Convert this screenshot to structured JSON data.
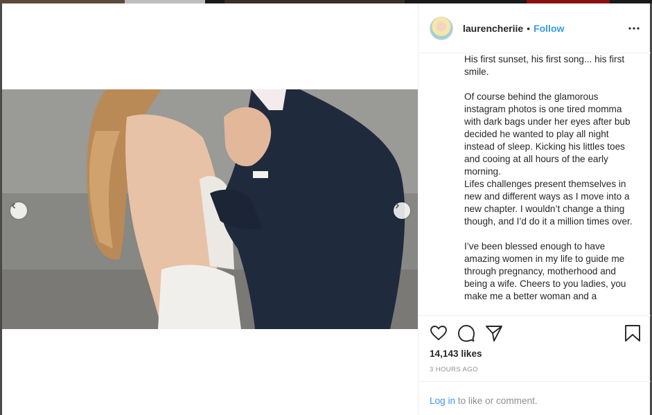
{
  "post": {
    "username": "laurencheriie",
    "separator": "•",
    "follow_label": "Follow",
    "more_icon": "more-options-icon",
    "caption": [
      "His first sunset, his first song... his first smile.",
      "",
      "Of course behind the glamorous instagram photos is one tired momma with dark bags under her eyes after bub decided he wanted to play all night instead of sleep. Kicking his littles toes and cooing at all hours of the early morning.",
      "Lifes challenges present themselves in new and different ways as I move into a new chapter. I wouldn’t change a thing though, and I’d do it a million times over.",
      "",
      "I’ve been blessed enough to have amazing women in my life to guide me through pregnancy, motherhood and being a wife. Cheers to you ladies, you make me a better woman and a"
    ],
    "likes": "14,143 likes",
    "timestamp": "3 HOURS AGO",
    "login_link": "Log in",
    "login_suffix": " to like or comment."
  },
  "media": {
    "prev_icon": "chevron-left-icon",
    "next_icon": "chevron-right-icon"
  },
  "colors": {
    "accent": "#3897f0",
    "text": "#262626",
    "muted": "#8e8e8e"
  }
}
